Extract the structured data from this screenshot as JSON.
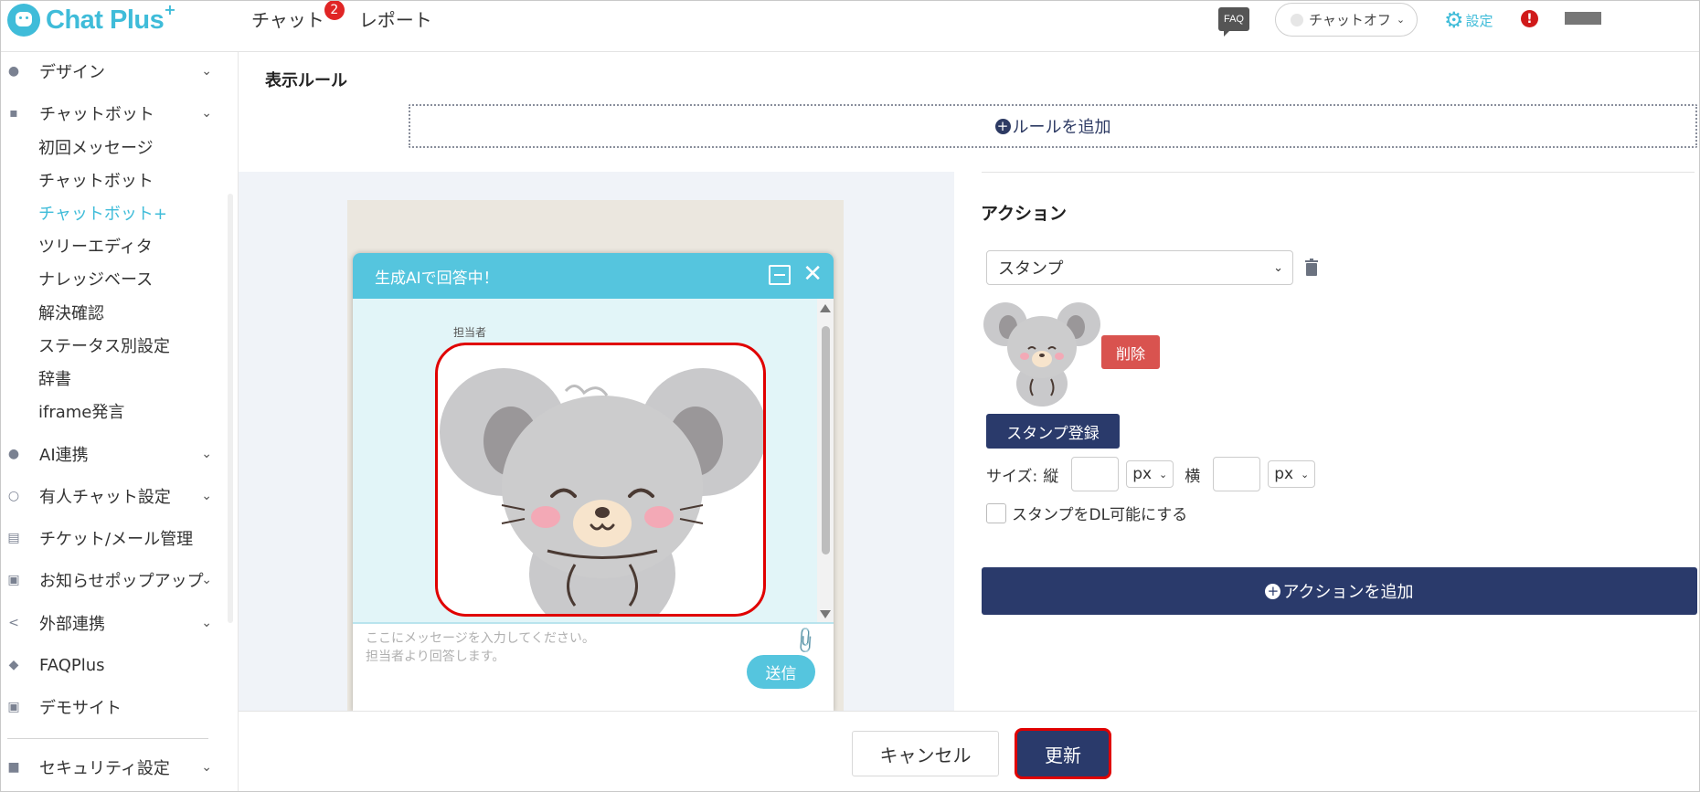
{
  "header": {
    "logo_text": "Chat Plus",
    "logo_plus": "+",
    "nav": [
      {
        "label": "チャット",
        "badge": "2"
      },
      {
        "label": "レポート"
      }
    ],
    "faq_icon_text": "FAQ",
    "chat_status": "チャットオフ",
    "settings_label": "設定",
    "alert": "!"
  },
  "sidebar": {
    "sections": [
      {
        "label": "デザイン",
        "icon": "palette-icon"
      },
      {
        "label": "チャットボット",
        "icon": "chat-bubble-icon"
      },
      {
        "label": "AI連携",
        "icon": "lightbulb-icon"
      },
      {
        "label": "有人チャット設定",
        "icon": "headset-icon"
      },
      {
        "label": "チケット/メール管理",
        "icon": "document-icon"
      },
      {
        "label": "お知らせポップアップ",
        "icon": "window-icon"
      },
      {
        "label": "外部連携",
        "icon": "share-icon"
      },
      {
        "label": "FAQPlus",
        "icon": "shield-icon"
      },
      {
        "label": "デモサイト",
        "icon": "monitor-icon"
      },
      {
        "label": "セキュリティ設定",
        "icon": "lock-icon"
      }
    ],
    "chatbot_items": [
      {
        "label": "初回メッセージ"
      },
      {
        "label": "チャットボット"
      },
      {
        "label": "チャットボット+"
      },
      {
        "label": "ツリーエディタ"
      },
      {
        "label": "ナレッジベース"
      },
      {
        "label": "解決確認"
      },
      {
        "label": "ステータス別設定"
      },
      {
        "label": "辞書"
      },
      {
        "label": "iframe発言"
      }
    ]
  },
  "rules": {
    "title": "表示ルール",
    "add_rule": "ルールを追加"
  },
  "preview": {
    "header_title": "生成AIで回答中！",
    "agent_label": "担当者",
    "input_placeholder": "ここにメッセージを入力してください。\n担当者より回答します。",
    "send_label": "送信"
  },
  "action": {
    "title": "アクション",
    "type_value": "スタンプ",
    "delete_label": "削除",
    "register_label": "スタンプ登録",
    "size_label": "サイズ:",
    "height_label": "縦",
    "width_label": "横",
    "unit": "px",
    "dl_label": "スタンプをDL可能にする",
    "add_action": "アクションを追加"
  },
  "footer": {
    "cancel_label": "キャンセル",
    "update_label": "更新"
  },
  "colors": {
    "brand": "#3fbcd9",
    "navy": "#2a3a6b",
    "danger": "#d9534f",
    "highlight": "#e00000"
  }
}
